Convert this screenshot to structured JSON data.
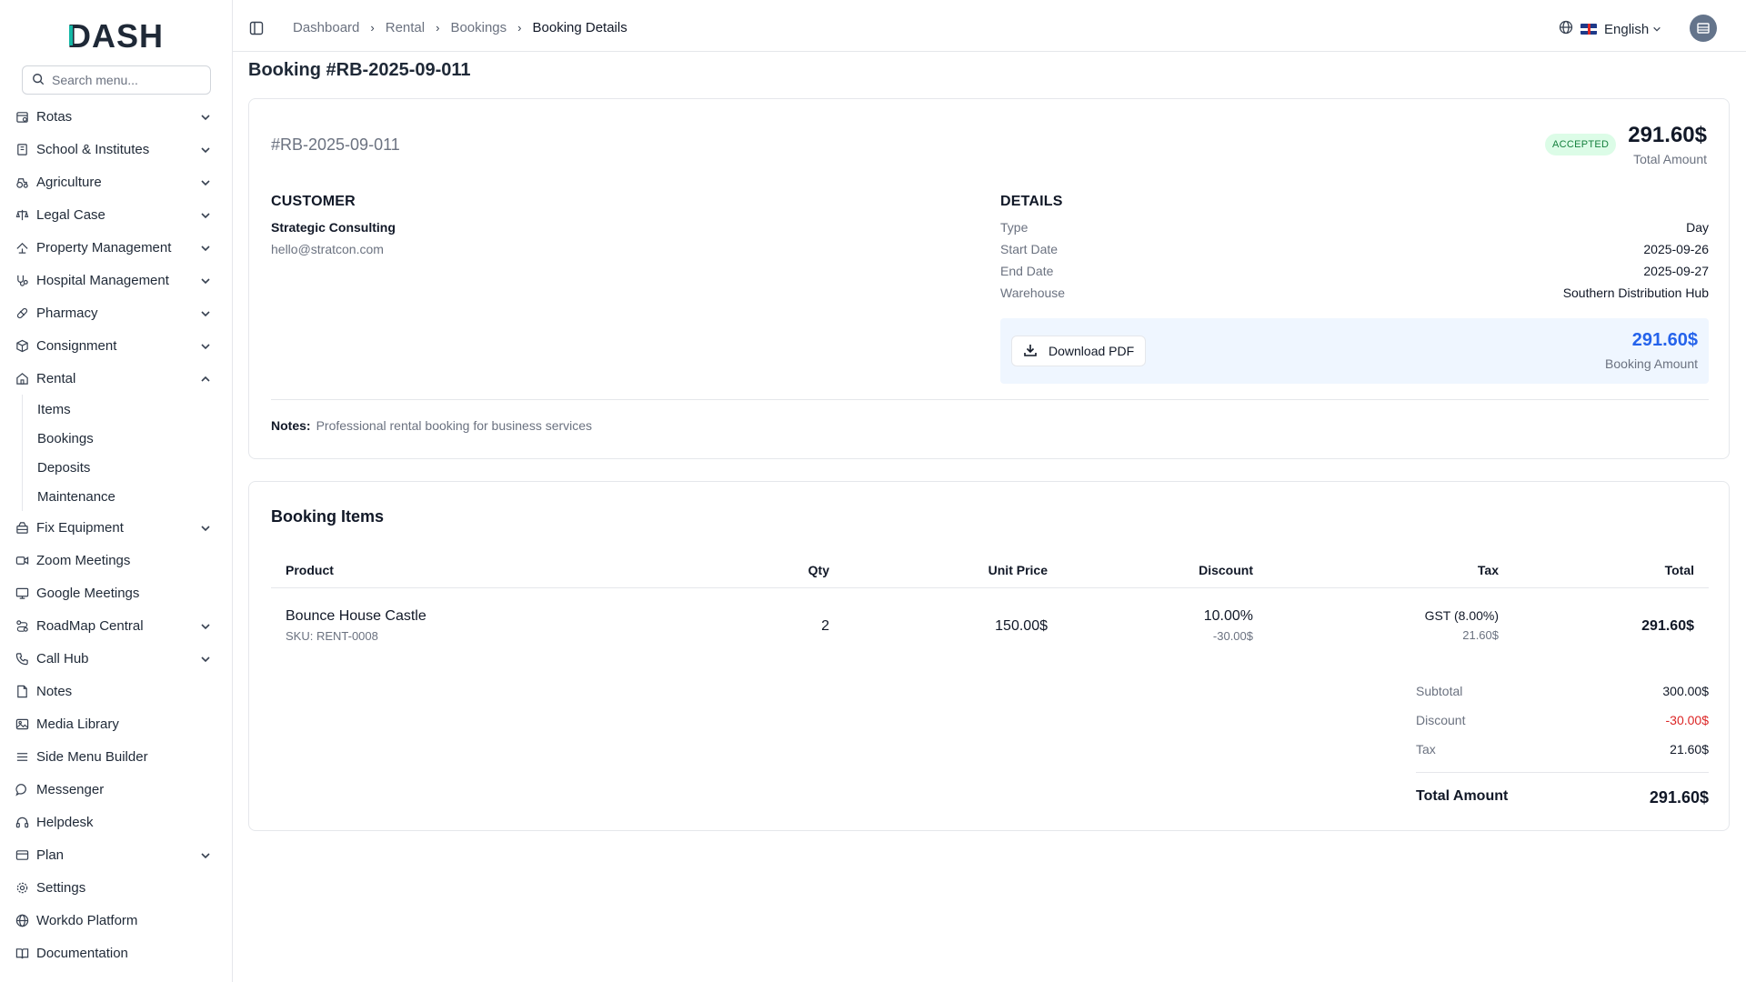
{
  "brand": {
    "logo_text": "DASH"
  },
  "search": {
    "placeholder": "Search menu..."
  },
  "sidebar": {
    "items": [
      {
        "label": "Rotas",
        "icon": "rotas-icon",
        "expandable": true
      },
      {
        "label": "School & Institutes",
        "icon": "school-icon",
        "expandable": true
      },
      {
        "label": "Agriculture",
        "icon": "agriculture-icon",
        "expandable": true
      },
      {
        "label": "Legal Case",
        "icon": "scale-icon",
        "expandable": true
      },
      {
        "label": "Property Management",
        "icon": "property-icon",
        "expandable": true
      },
      {
        "label": "Hospital Management",
        "icon": "stethoscope-icon",
        "expandable": true
      },
      {
        "label": "Pharmacy",
        "icon": "pill-icon",
        "expandable": true
      },
      {
        "label": "Consignment",
        "icon": "package-icon",
        "expandable": true
      },
      {
        "label": "Rental",
        "icon": "home-icon",
        "expandable": true,
        "expanded": true
      },
      {
        "label": "Fix Equipment",
        "icon": "equipment-icon",
        "expandable": true
      },
      {
        "label": "Zoom Meetings",
        "icon": "video-icon",
        "expandable": false
      },
      {
        "label": "Google Meetings",
        "icon": "monitor-icon",
        "expandable": false
      },
      {
        "label": "RoadMap Central",
        "icon": "roadmap-icon",
        "expandable": true
      },
      {
        "label": "Call Hub",
        "icon": "phone-icon",
        "expandable": true
      },
      {
        "label": "Notes",
        "icon": "file-icon",
        "expandable": false
      },
      {
        "label": "Media Library",
        "icon": "image-icon",
        "expandable": false
      },
      {
        "label": "Side Menu Builder",
        "icon": "menu-icon",
        "expandable": false
      },
      {
        "label": "Messenger",
        "icon": "message-icon",
        "expandable": false
      },
      {
        "label": "Helpdesk",
        "icon": "headset-icon",
        "expandable": false
      },
      {
        "label": "Plan",
        "icon": "card-icon",
        "expandable": true
      },
      {
        "label": "Settings",
        "icon": "gear-icon",
        "expandable": false
      },
      {
        "label": "Workdo Platform",
        "icon": "globe-icon",
        "expandable": false
      },
      {
        "label": "Documentation",
        "icon": "book-icon",
        "expandable": false
      }
    ],
    "rental_sub": [
      "Items",
      "Bookings",
      "Deposits",
      "Maintenance"
    ]
  },
  "breadcrumb": [
    "Dashboard",
    "Rental",
    "Bookings",
    "Booking Details"
  ],
  "language": {
    "label": "English"
  },
  "page": {
    "title": "Booking #RB-2025-09-011"
  },
  "booking": {
    "number": "#RB-2025-09-011",
    "status": "ACCEPTED",
    "total_amount": "291.60$",
    "total_amount_label": "Total Amount",
    "customer_heading": "CUSTOMER",
    "customer_name": "Strategic Consulting",
    "customer_email": "hello@stratcon.com",
    "details_heading": "DETAILS",
    "details": [
      {
        "key": "Type",
        "value": "Day"
      },
      {
        "key": "Start Date",
        "value": "2025-09-26"
      },
      {
        "key": "End Date",
        "value": "2025-09-27"
      },
      {
        "key": "Warehouse",
        "value": "Southern Distribution Hub"
      }
    ],
    "download_label": "Download PDF",
    "booking_amount": "291.60$",
    "booking_amount_label": "Booking Amount",
    "notes_label": "Notes:",
    "notes": "Professional rental booking for business services"
  },
  "items": {
    "heading": "Booking Items",
    "columns": [
      "Product",
      "Qty",
      "Unit Price",
      "Discount",
      "Tax",
      "Total"
    ],
    "rows": [
      {
        "product": "Bounce House Castle",
        "sku": "SKU: RENT-0008",
        "qty": "2",
        "unit_price": "150.00$",
        "discount_pct": "10.00%",
        "discount_amt": "-30.00$",
        "tax_name": "GST (8.00%)",
        "tax_amt": "21.60$",
        "total": "291.60$"
      }
    ],
    "summary": {
      "subtotal_label": "Subtotal",
      "subtotal": "300.00$",
      "discount_label": "Discount",
      "discount": "-30.00$",
      "tax_label": "Tax",
      "tax": "21.60$",
      "total_label": "Total Amount",
      "total": "291.60$"
    }
  },
  "colors": {
    "brand_teal": "#14b8a6",
    "accent_blue": "#2563eb",
    "status_green_bg": "#dcfce7",
    "status_green_text": "#15803d",
    "negative_red": "#dc2626"
  }
}
